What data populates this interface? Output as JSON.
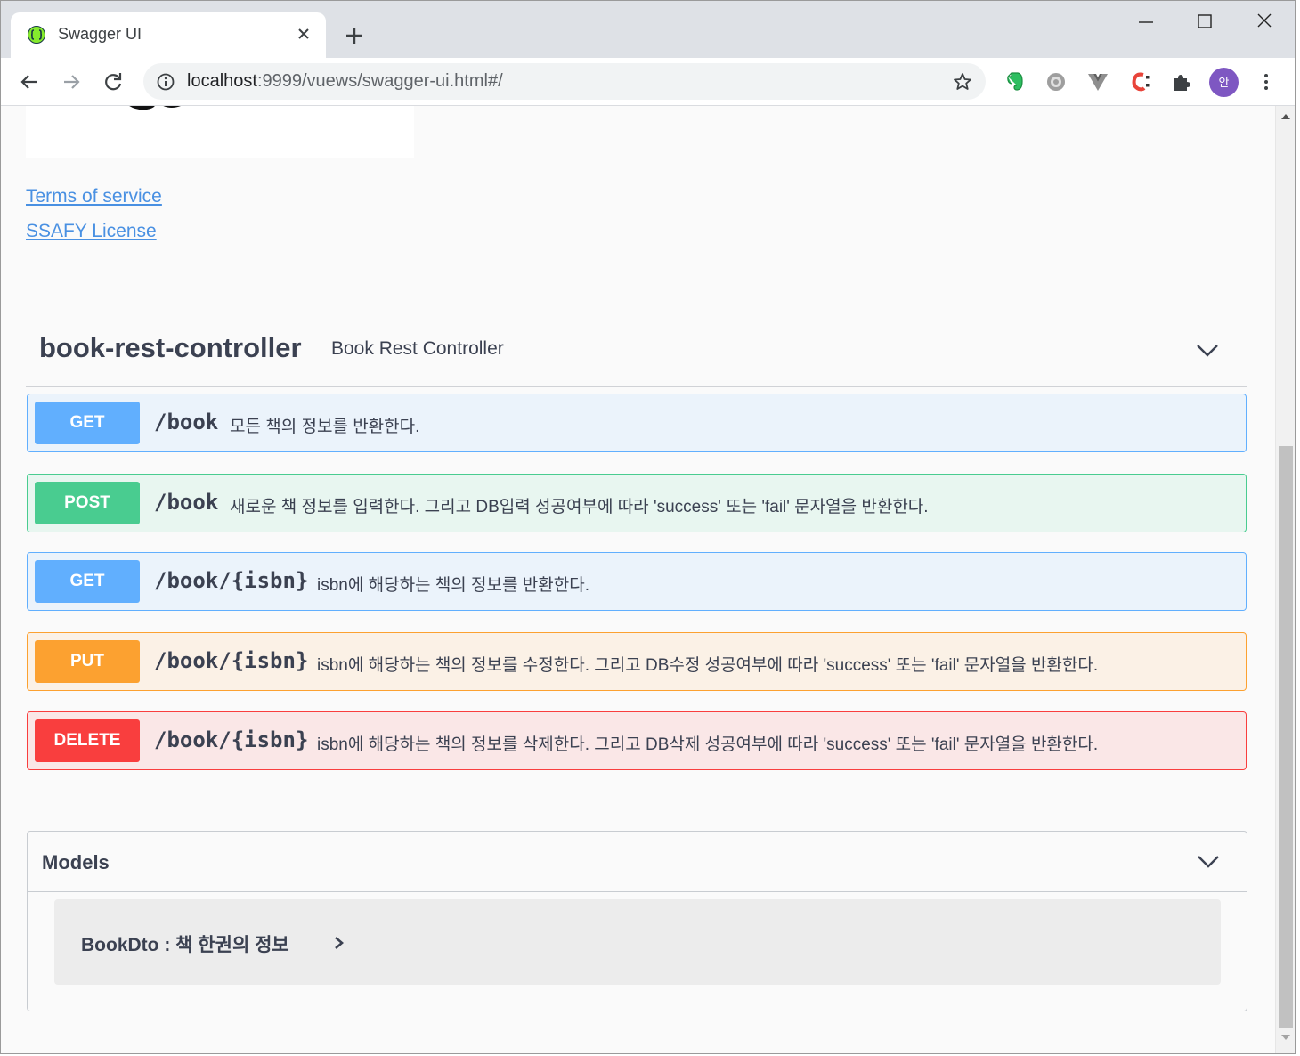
{
  "browser": {
    "tab_title": "Swagger UI",
    "url_host": "localhost",
    "url_rest": ":9999/vuews/swagger-ui.html#/",
    "profile_initial": "안"
  },
  "info": {
    "terms_link": "Terms of service",
    "license_link": "SSAFY License"
  },
  "tag": {
    "name": "book-rest-controller",
    "description": "Book Rest Controller"
  },
  "operations": [
    {
      "method": "GET",
      "path": "/book",
      "summary": "모든 책의 정보를 반환한다."
    },
    {
      "method": "POST",
      "path": "/book",
      "summary": "새로운 책 정보를 입력한다. 그리고 DB입력 성공여부에 따라 'success' 또는 'fail' 문자열을 반환한다."
    },
    {
      "method": "GET",
      "path": "/book/{isbn}",
      "summary": "isbn에 해당하는 책의 정보를 반환한다."
    },
    {
      "method": "PUT",
      "path": "/book/{isbn}",
      "summary": "isbn에 해당하는 책의 정보를 수정한다. 그리고 DB수정 성공여부에 따라 'success' 또는 'fail' 문자열을 반환한다."
    },
    {
      "method": "DELETE",
      "path": "/book/{isbn}",
      "summary": "isbn에 해당하는 책의 정보를 삭제한다. 그리고 DB삭제 성공여부에 따라 'success' 또는 'fail' 문자열을 반환한다."
    }
  ],
  "models": {
    "title": "Models",
    "items": [
      {
        "label": "BookDto : 책 한권의 정보"
      }
    ]
  },
  "colors": {
    "get": "#61affe",
    "post": "#49cc90",
    "put": "#fca130",
    "delete": "#f93e3e",
    "link": "#4990e2"
  },
  "icons": {
    "favicon": "swagger-icon",
    "tab_close": "close-icon",
    "new_tab": "plus-icon",
    "back": "arrow-left-icon",
    "forward": "arrow-right-icon",
    "reload": "reload-icon",
    "info": "info-icon",
    "bookmark": "star-icon",
    "extensions": [
      "evernote-icon",
      "ghost-icon",
      "vue-devtools-icon",
      "colorzilla-icon",
      "puzzle-icon"
    ],
    "menu": "kebab-menu-icon",
    "collapse": "chevron-down-icon",
    "expand": "chevron-right-icon"
  }
}
